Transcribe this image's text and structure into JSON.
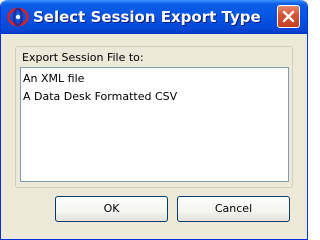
{
  "window": {
    "title": "Select Session Export Type",
    "icon": "app-logo-icon",
    "close_icon": "close-icon"
  },
  "dialog": {
    "group_label": "Export Session File to:",
    "options": [
      {
        "label": "An XML file"
      },
      {
        "label": "A Data Desk Formatted CSV"
      }
    ],
    "ok_label": "OK",
    "cancel_label": "Cancel"
  },
  "colors": {
    "titlebar": "#0554e3",
    "close_button": "#d6563a",
    "dialog_face": "#ece9d8",
    "list_border": "#7f9db9"
  }
}
